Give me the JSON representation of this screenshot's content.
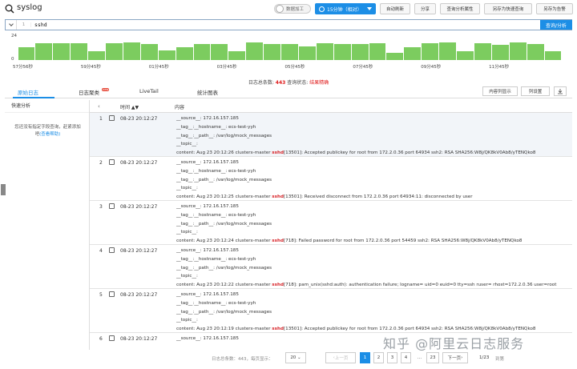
{
  "header": {
    "app_title": "syslog",
    "toggle_label": "数据加工",
    "time_range": "15分钟（相对）",
    "buttons": [
      "自动刷新",
      "分享",
      "查询分析属性",
      "另存为快速查询",
      "另存为告警"
    ]
  },
  "search": {
    "line_number": "1",
    "query": "sshd",
    "submit_label": "查询/分析"
  },
  "histogram": {
    "y_ticks": [
      "24",
      "0"
    ],
    "x_labels": [
      "57分56秒",
      "59分45秒",
      "01分45秒",
      "03分45秒",
      "05分45秒",
      "07分45秒",
      "09分45秒",
      "11分45秒"
    ],
    "counts": [
      13,
      17,
      17,
      17,
      9,
      17,
      18,
      16,
      10,
      13,
      16,
      16,
      9,
      18,
      16,
      16,
      14,
      17,
      16,
      16,
      17,
      7,
      13,
      17,
      18,
      9,
      17,
      15,
      18,
      16,
      9
    ],
    "max": 24,
    "bar_color": "#7ccc5f"
  },
  "summary": {
    "total_label": "日志总条数:",
    "total_count": "443",
    "status_label": "查询状态:",
    "status_value": "结果精确"
  },
  "tabs": {
    "items": [
      "原始日志",
      "日志聚类",
      "LiveTail",
      "统计图表"
    ],
    "badge": "new",
    "content_display": "内容列显示",
    "column_settings": "列设置"
  },
  "left_panel": {
    "title": "快速分析",
    "message": "您还没有指定字段查询，赶紧添加吧",
    "help_link": "(查看帮助)"
  },
  "table": {
    "col_time": "时间",
    "col_content": "内容",
    "rows": [
      {
        "index": "1",
        "time": "08-23 20:12:27",
        "source": "__source__:  172.16.157.185",
        "hostname": "__tag__:__hostname__:  ecs-test-yyh",
        "path": "__tag__:__path__:  /var/log/mock_messages",
        "topic": "__topic__:",
        "content_pre": "content:  Aug 23 20:12:26 clusterx-master ",
        "content_hl": "sshd",
        "content_post": "[13501]: Accepted publickey for root from 172.2.0.36 port 64934 ssh2: RSA SHA256:W8j/QK8kV0Ab8/yTENQko8"
      },
      {
        "index": "2",
        "time": "08-23 20:12:27",
        "source": "__source__:  172.16.157.185",
        "hostname": "__tag__:__hostname__:  ecs-test-yyh",
        "path": "__tag__:__path__:  /var/log/mock_messages",
        "topic": "__topic__:",
        "content_pre": "content:  Aug 23 20:12:25 clusterx-master ",
        "content_hl": "sshd",
        "content_post": "[13501]: Received disconnect from 172.2.0.36 port 64934:11: disconnected by user"
      },
      {
        "index": "3",
        "time": "08-23 20:12:27",
        "source": "__source__:  172.16.157.185",
        "hostname": "__tag__:__hostname__:  ecs-test-yyh",
        "path": "__tag__:__path__:  /var/log/mock_messages",
        "topic": "__topic__:",
        "content_pre": "content:  Aug 23 20:12:24 clusterx-master ",
        "content_hl": "sshd",
        "content_post": "[718]: Failed password for root from 172.2.0.36 port 54459 ssh2: RSA SHA256:W8j/QK8kV0Ab8/yTENQko8"
      },
      {
        "index": "4",
        "time": "08-23 20:12:27",
        "source": "__source__:  172.16.157.185",
        "hostname": "__tag__:__hostname__:  ecs-test-yyh",
        "path": "__tag__:__path__:  /var/log/mock_messages",
        "topic": "__topic__:",
        "content_pre": "content:  Aug 23 20:12:22 clusterx-master ",
        "content_hl": "sshd",
        "content_post": "[718]: pam_unix(sshd:auth): authentication failure; logname= uid=0 euid=0 tty=ssh ruser= rhost=172.2.0.36  user=root"
      },
      {
        "index": "5",
        "time": "08-23 20:12:27",
        "source": "__source__:  172.16.157.185",
        "hostname": "__tag__:__hostname__:  ecs-test-yyh",
        "path": "__tag__:__path__:  /var/log/mock_messages",
        "topic": "__topic__:",
        "content_pre": "content:  Aug 23 20:12:19 clusterx-master ",
        "content_hl": "sshd",
        "content_post": "[13501]: Accepted publickey for root from 172.2.0.36 port 64934 ssh2: RSA SHA256:W8j/QK8kV0Ab8/yTENQko8"
      },
      {
        "index": "6",
        "time": "08-23 20:12:27",
        "source": "__source__:  172.16.157.185",
        "hostname": "",
        "path": "",
        "topic": "",
        "content_pre": "",
        "content_hl": "",
        "content_post": ""
      }
    ]
  },
  "pager": {
    "total_label": "日志总条数：443，每页显示：",
    "page_size": "20",
    "prev": "上一页",
    "pages": [
      "1",
      "2",
      "3",
      "4",
      "...",
      "23"
    ],
    "next": "下一页",
    "page_info": "1/23",
    "goto": "到第"
  },
  "watermark": "知乎 @阿里云日志服务"
}
